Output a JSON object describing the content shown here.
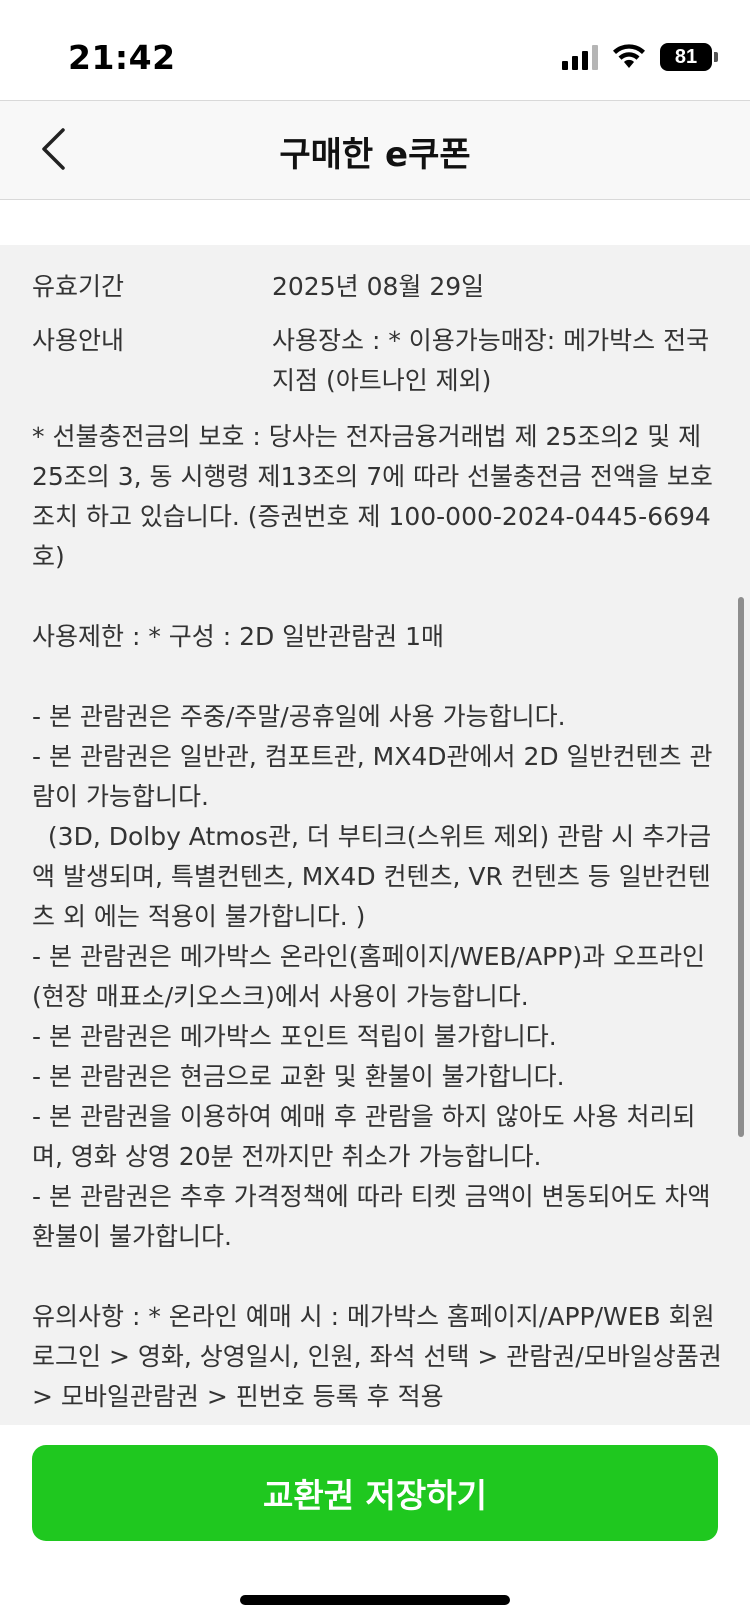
{
  "status_bar": {
    "time": "21:42",
    "battery": "81",
    "icons": [
      "signal-icon",
      "wifi-icon",
      "battery-icon"
    ]
  },
  "header": {
    "title": "구매한 e쿠폰",
    "back_icon": "chevron-left-icon"
  },
  "details": {
    "validity_label": "유효기간",
    "validity_value": "2025년 08월 29일",
    "guide_label": "사용안내",
    "guide_value": "사용장소 : * 이용가능매장: 메가박스 전국지점 (아트나인 제외)",
    "guide_body": "* 선불충전금의 보호 : 당사는 전자금융거래법 제 25조의2 및 제25조의 3, 동 시행령 제13조의 7에 따라 선불충전금 전액을 보호조치 하고 있습니다. (증권번호 제 100-000-2024-0445-6694 호)\n\n사용제한 : * 구성 : 2D 일반관람권 1매\n\n- 본 관람권은 주중/주말/공휴일에 사용 가능합니다.\n- 본 관람권은 일반관, 컴포트관, MX4D관에서 2D 일반컨텐츠 관람이 가능합니다.\n  (3D, Dolby Atmos관, 더 부티크(스위트 제외) 관람 시 추가금액 발생되며, 특별컨텐츠, MX4D 컨텐츠, VR 컨텐츠 등 일반컨텐츠 외 에는 적용이 불가합니다. )\n- 본 관람권은 메가박스 온라인(홈페이지/WEB/APP)과 오프라인(현장 매표소/키오스크)에서 사용이 가능합니다.\n- 본 관람권은 메가박스 포인트 적립이 불가합니다.\n- 본 관람권은 현금으로 교환 및 환불이 불가합니다.\n- 본 관람권을 이용하여 예매 후 관람을 하지 않아도 사용 처리되며, 영화 상영 20분 전까지만 취소가 가능합니다.\n- 본 관람권은 추후 가격정책에 따라 티켓 금액이 변동되어도 차액 환불이 불가합니다.\n\n유의사항 : * 온라인 예매 시 : 메가박스 홈페이지/APP/WEB 회원 로그인 > 영화, 상영일시, 인원, 좌석 선택 > 관람권/모바일상품권 > 모바일관람권 > 핀번호 등록 후 적용"
  },
  "footer": {
    "save_label": "교환권 저장하기",
    "button_color": "#1fc81f"
  }
}
